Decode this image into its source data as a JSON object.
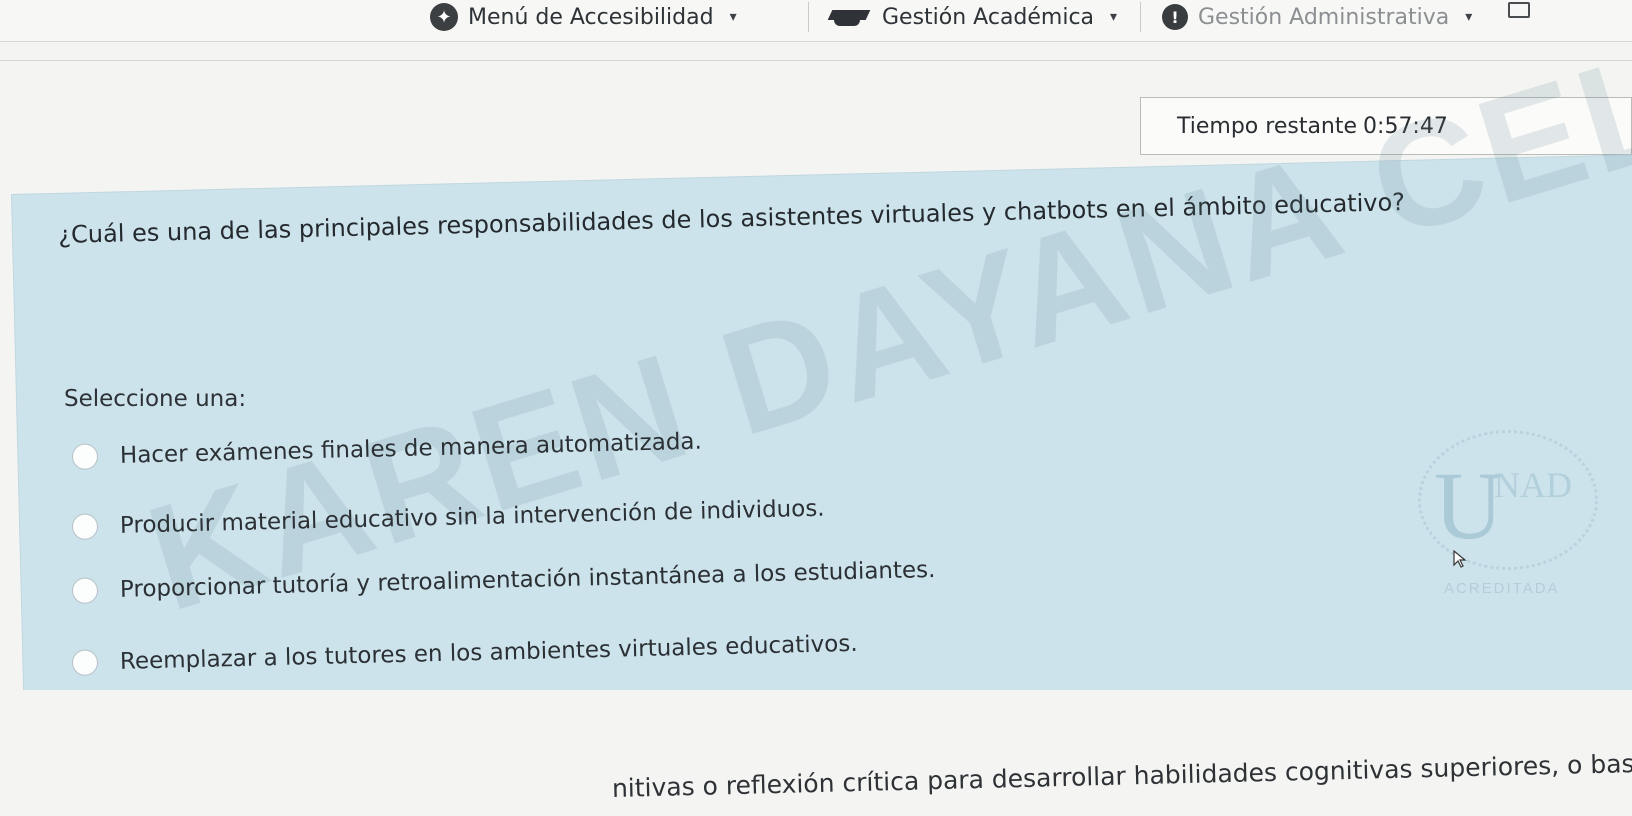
{
  "nav": {
    "accessibility_label": "Menú de Accesibilidad",
    "academic_label": "Gestión Académica",
    "admin_label": "Gestión Administrativa",
    "accessibility_icon": "accessibility-icon",
    "academic_icon": "graduation-cap-icon",
    "admin_icon": "info-icon"
  },
  "timer": {
    "label": "Tiempo restante",
    "value": "0:57:47"
  },
  "question": {
    "text": "¿Cuál es una de las principales responsabilidades de los asistentes virtuales y chatbots en el ámbito educativo?",
    "select_label": "Seleccione una:",
    "options": [
      "Hacer exámenes finales de manera automatizada.",
      "Producir material educativo sin la intervención de individuos.",
      "Proporcionar tutoría y retroalimentación instantánea a los estudiantes.",
      "Reemplazar a los tutores en los ambientes virtuales educativos."
    ]
  },
  "watermark": "KAREN DAYANA CELIS GOMEZ",
  "logo": {
    "u": "U",
    "nad": "NAD",
    "accredited": "ACREDITADA"
  },
  "bottom_text": "nitivas o reflexión crítica para desarrollar habilidades cognitivas superiores, o basta co",
  "colors": {
    "card_background": "#cde3ec",
    "page_background": "#f4f5f2"
  }
}
